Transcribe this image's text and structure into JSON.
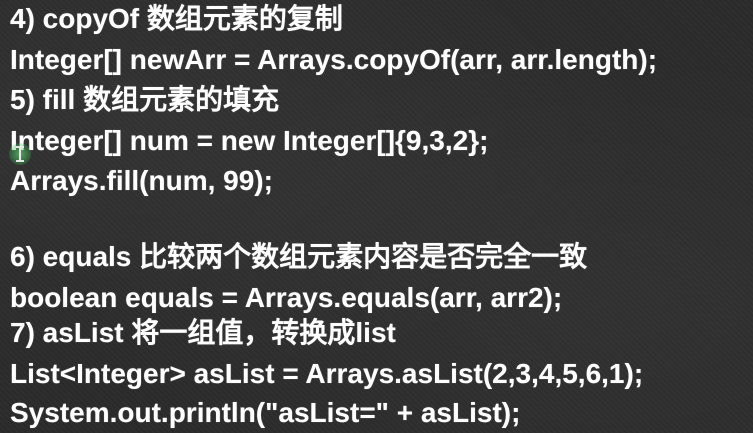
{
  "lines": [
    {
      "text": "4) copyOf 数组元素的复制"
    },
    {
      "text": "Integer[] newArr = Arrays.copyOf(arr, arr.length);"
    },
    {
      "text": "5) fill 数组元素的填充"
    },
    {
      "text": "Integer[] num = new Integer[]{9,3,2};"
    },
    {
      "text": "Arrays.fill(num, 99);"
    },
    {
      "text": "6) equals 比较两个数组元素内容是否完全一致"
    },
    {
      "text": "boolean equals = Arrays.equals(arr, arr2);"
    },
    {
      "text": "7) asList 将一组值，转换成list"
    },
    {
      "text": "List<Integer> asList = Arrays.asList(2,3,4,5,6,1);"
    },
    {
      "text": "System.out.println(\"asList=\" + asList);"
    }
  ],
  "colors": {
    "background": "#2b2b2b",
    "text": "#ffffff",
    "cursor_highlight": "#5fd97a"
  },
  "cursor": {
    "icon": "text-cursor-icon"
  }
}
